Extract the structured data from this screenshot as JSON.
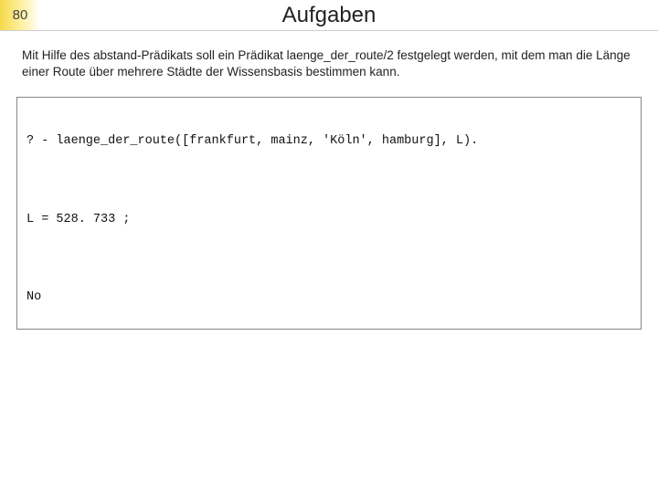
{
  "header": {
    "slide_number": "80",
    "title": "Aufgaben"
  },
  "body": {
    "paragraph": "Mit Hilfe des abstand-Prädikats soll ein Prädikat laenge_der_route/2 festgelegt werden, mit dem man die Länge einer Route über mehrere Städte der Wissensbasis bestimmen kann."
  },
  "code": {
    "line1": "? - laenge_der_route([frankfurt, mainz, 'Köln', hamburg], L).",
    "line2": "L = 528. 733 ;",
    "line3": "No"
  }
}
